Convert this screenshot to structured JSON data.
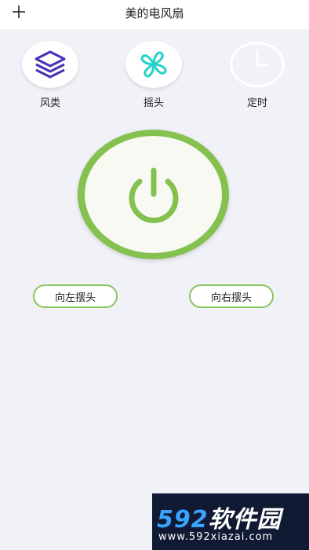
{
  "header": {
    "add_icon": "plus-icon",
    "title": "美的电风扇"
  },
  "modes": [
    {
      "label": "风类",
      "icon": "layers-icon",
      "color": "#4a2fb8"
    },
    {
      "label": "摇头",
      "icon": "fan-icon",
      "color": "#22d3c8"
    },
    {
      "label": "定时",
      "icon": "clock-icon",
      "color": "#ffffff"
    }
  ],
  "power": {
    "icon": "power-icon",
    "color": "#84c14e"
  },
  "swing": {
    "left_label": "向左摆头",
    "right_label": "向右摆头"
  },
  "watermark": {
    "brand_num": "592",
    "brand_cn": "软件园",
    "url": "www.592xiazai.com"
  }
}
